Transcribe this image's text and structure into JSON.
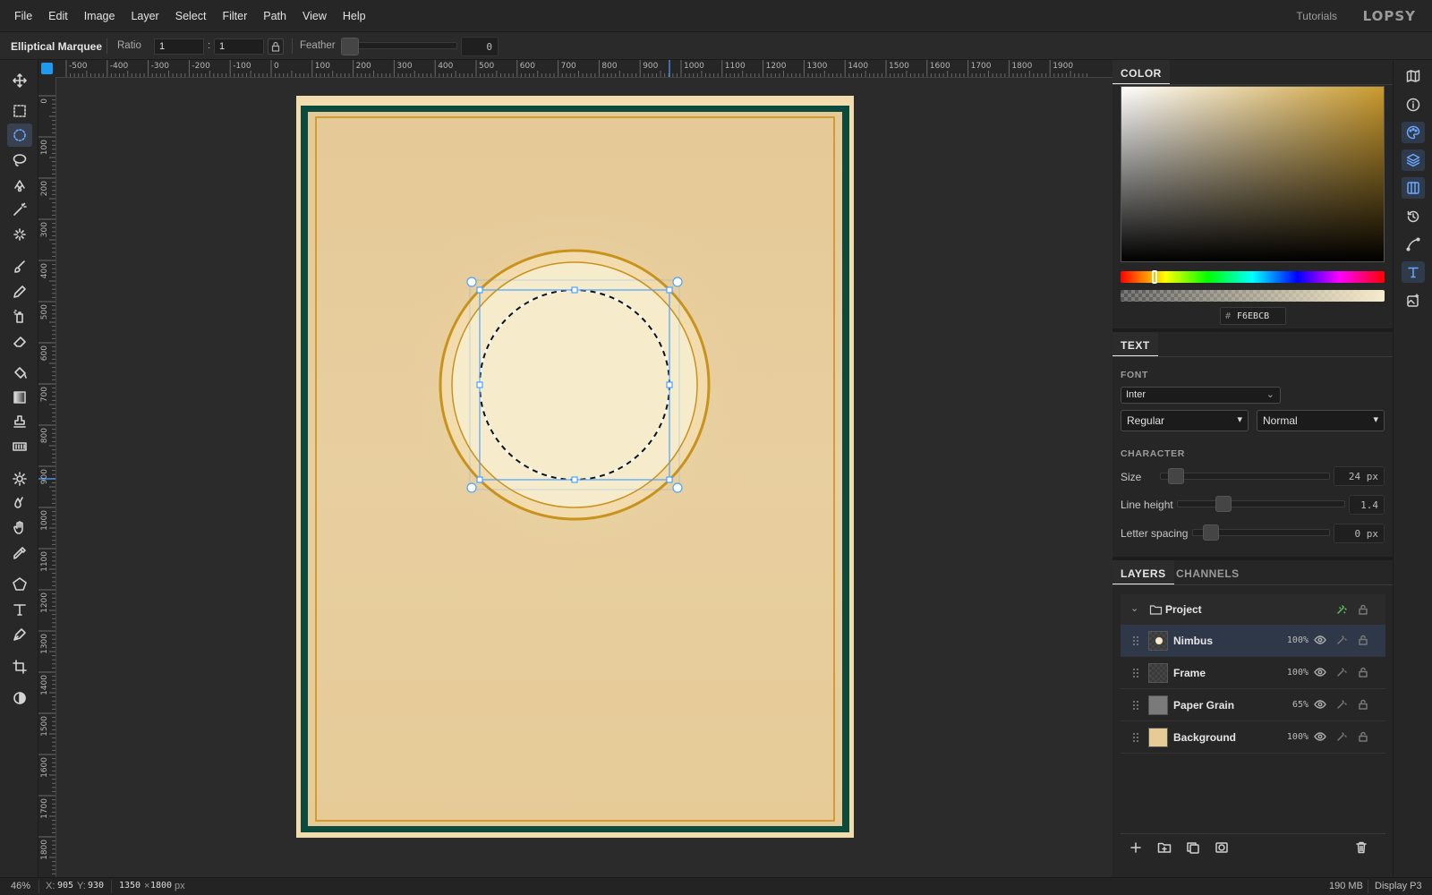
{
  "menubar": {
    "items": [
      "File",
      "Edit",
      "Image",
      "Layer",
      "Select",
      "Filter",
      "Path",
      "View",
      "Help"
    ],
    "tutorials": "Tutorials",
    "brand": "LOPSY"
  },
  "options": {
    "tool_name": "Elliptical Marquee",
    "ratio_label": "Ratio",
    "ratio_w": "1",
    "ratio_sep": ":",
    "ratio_h": "1",
    "feather_label": "Feather",
    "feather_value": "0"
  },
  "ruler": {
    "top_labels": [
      "-500",
      "-400",
      "-300",
      "-200",
      "-100",
      "0",
      "100",
      "200",
      "300",
      "400",
      "500",
      "600",
      "700",
      "800",
      "900",
      "1000",
      "1100",
      "1200",
      "1300",
      "1400",
      "1500",
      "1600",
      "1700",
      "1800",
      "1900"
    ],
    "left_labels": [
      "0",
      "100",
      "200",
      "300",
      "400",
      "500",
      "600",
      "700",
      "800",
      "900",
      "1000",
      "1100",
      "1200",
      "1300",
      "1400",
      "1500",
      "1600",
      "1700",
      "1800"
    ]
  },
  "toolbar": {
    "tools": [
      "move",
      "rect-marquee",
      "elliptical-marquee",
      "lasso",
      "magnetic-lasso",
      "magic-wand",
      "quick-select",
      "brush",
      "pencil",
      "spray",
      "eraser",
      "paint-bucket",
      "gradient",
      "stamp",
      "pattern",
      "dodge",
      "burn",
      "hand",
      "eyedropper",
      "shape",
      "type",
      "pen",
      "crop",
      "invert"
    ],
    "active": "elliptical-marquee"
  },
  "color_panel": {
    "tab": "COLOR",
    "hex_prefix": "#",
    "hex": "F6EBCB",
    "accent": "#c99a2e"
  },
  "text_panel": {
    "tab": "TEXT",
    "font_label": "FONT",
    "font": "Inter",
    "weight": "Regular",
    "style": "Normal",
    "character_label": "CHARACTER",
    "size_label": "Size",
    "size": "24 px",
    "line_height_label": "Line height",
    "line_height": "1.4",
    "letter_spacing_label": "Letter spacing",
    "letter_spacing": "0 px"
  },
  "layers_panel": {
    "tab_layers": "LAYERS",
    "tab_channels": "CHANNELS",
    "group": "Project",
    "layers": [
      {
        "name": "Nimbus",
        "opacity": "100%"
      },
      {
        "name": "Frame",
        "opacity": "100%"
      },
      {
        "name": "Paper Grain",
        "opacity": "65%"
      },
      {
        "name": "Background",
        "opacity": "100%"
      }
    ]
  },
  "status": {
    "zoom": "46%",
    "x_label": "X:",
    "x": "905",
    "y_label": "Y:",
    "y": "930",
    "doc_w": "1350",
    "doc_sep": "×",
    "doc_h": "1800",
    "doc_unit": "px",
    "memory": "190 MB",
    "profile": "Display P3"
  },
  "colors": {
    "paper": "#e6cb97",
    "frame_green": "#0c4a3e",
    "gold": "#c8921c",
    "nimbus": "#f6ebcb",
    "selection": "#4aa3ff"
  }
}
